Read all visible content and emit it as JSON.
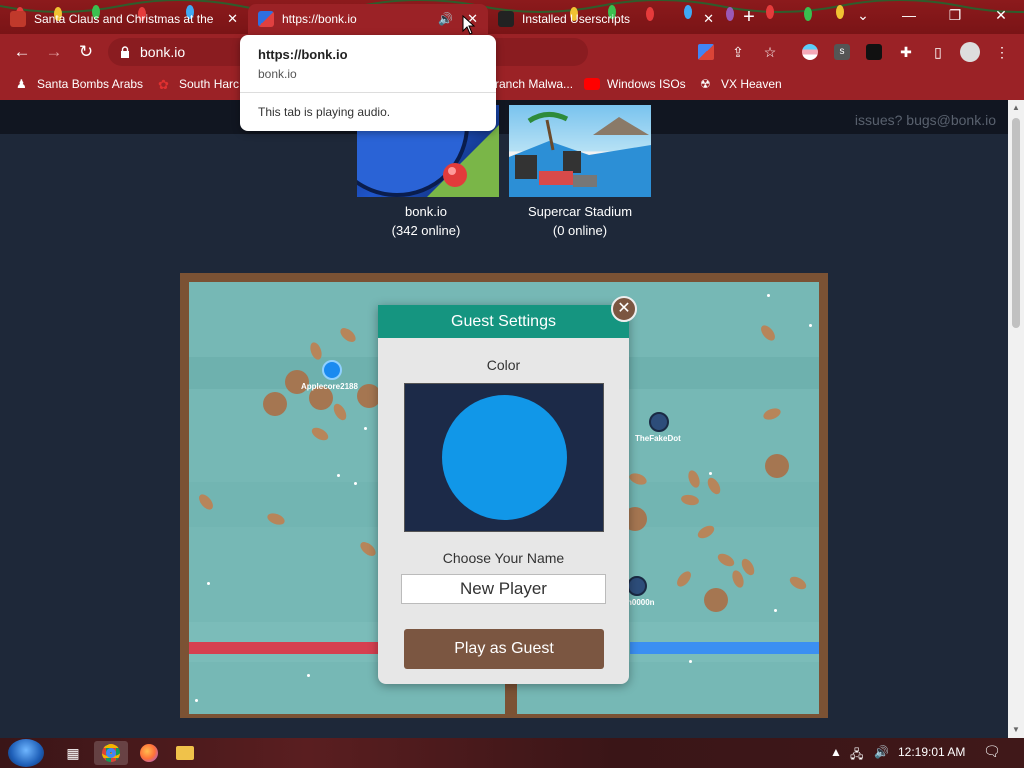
{
  "browser": {
    "tabs": [
      {
        "title": "Santa Claus and Christmas at the",
        "active": false
      },
      {
        "title": "https://bonk.io",
        "active": true,
        "audio": true
      },
      {
        "title": "Installed Userscripts",
        "active": false
      }
    ],
    "omnibox": {
      "url": "bonk.io"
    },
    "bookmarks": [
      {
        "label": "Santa Bombs Arabs"
      },
      {
        "label": "South Harc"
      },
      {
        "label": "ranch Malwa..."
      },
      {
        "label": "Windows ISOs"
      },
      {
        "label": "VX Heaven"
      }
    ],
    "hover_card": {
      "title": "https://bonk.io",
      "domain": "bonk.io",
      "audio_note": "This tab is playing audio."
    }
  },
  "page": {
    "issues_text": "issues? bugs@bonk.io",
    "games": [
      {
        "name": "bonk.io",
        "online": "(342 online)"
      },
      {
        "name": "Supercar Stadium",
        "online": "(0 online)"
      }
    ],
    "arena_players": [
      {
        "name": "Applecore2188"
      },
      {
        "name": "TheFakeDot"
      },
      {
        "name": "n0000n"
      }
    ],
    "guest_dialog": {
      "title": "Guest Settings",
      "close_glyph": "✕",
      "color_label": "Color",
      "selected_color": "#1197e8",
      "name_label": "Choose Your Name",
      "name_value": "New Player",
      "play_button": "Play as Guest"
    }
  },
  "taskbar": {
    "clock": "12:19:01 AM"
  },
  "colors": {
    "chrome_red": "#9b2226",
    "dialog_header": "#159580",
    "play_button": "#7b5641",
    "red_team": "#d64050",
    "blue_team": "#3b8ff2"
  }
}
